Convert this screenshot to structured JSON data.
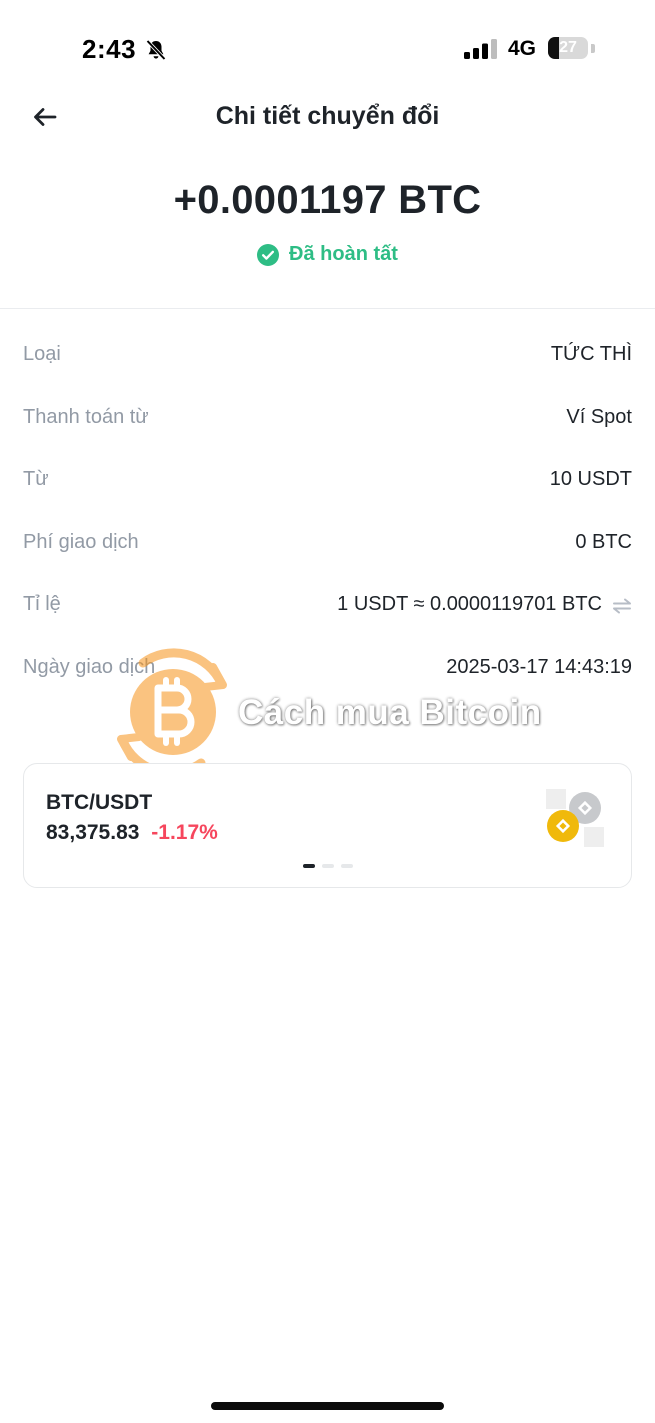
{
  "status_bar": {
    "time": "2:43",
    "network": "4G",
    "battery": "27",
    "battery_level": 27
  },
  "header": {
    "title": "Chi tiết chuyển đổi",
    "back_icon": "arrow-left-icon"
  },
  "summary": {
    "amount": "+0.0001197 BTC",
    "status": "Đã hoàn tất",
    "status_icon": "check-circle-icon",
    "status_color": "#2ebd85"
  },
  "details": {
    "type": {
      "label": "Loại",
      "value": "TỨC THÌ"
    },
    "pay_from": {
      "label": "Thanh toán từ",
      "value": "Ví Spot"
    },
    "from": {
      "label": "Từ",
      "value": "10 USDT"
    },
    "fee": {
      "label": "Phí giao dịch",
      "value": "0 BTC"
    },
    "rate": {
      "label": "Tỉ lệ",
      "value": "1 USDT ≈ 0.0000119701 BTC",
      "icon": "swap-arrows-icon"
    },
    "date": {
      "label": "Ngày giao dịch",
      "value": "2025-03-17 14:43:19"
    }
  },
  "watermark": {
    "text": "Cách mua Bitcoin",
    "logo_icon": "bitcoin-logo-icon"
  },
  "ticker": {
    "pair": "BTC/USDT",
    "price": "83,375.83",
    "change": "-1.17%",
    "change_color": "#f6465d",
    "logo_icon": "binance-coin-icon",
    "page_count": 3,
    "active_page": 1
  }
}
